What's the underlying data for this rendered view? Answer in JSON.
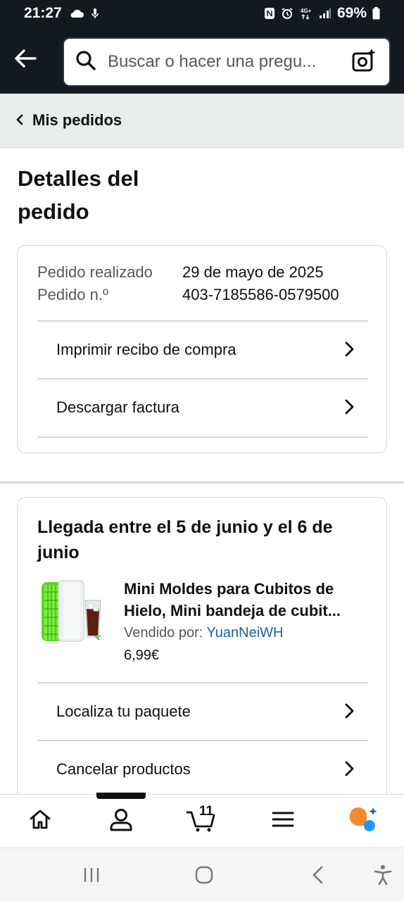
{
  "status_bar": {
    "time": "21:27",
    "battery": "69%"
  },
  "search": {
    "placeholder": "Buscar o hacer una pregu..."
  },
  "breadcrumb": {
    "label": "Mis pedidos"
  },
  "page": {
    "title": "Detalles del pedido"
  },
  "order": {
    "placed_label": "Pedido realizado",
    "placed_value": "29 de mayo de 2025",
    "number_label": "Pedido n.º",
    "number_value": "403-7185586-0579500",
    "actions": [
      {
        "label": "Imprimir recibo de compra"
      },
      {
        "label": "Descargar factura"
      }
    ]
  },
  "shipment": {
    "arrival": "Llegada entre el 5 de junio y el 6 de junio",
    "product": {
      "title": "Mini Moldes para Cubitos de Hielo, Mini bandeja de cubit...",
      "seller_label": "Vendido por:",
      "seller_name": "YuanNeiWH",
      "price": "6,99€"
    },
    "actions": [
      {
        "label": "Localiza tu paquete"
      },
      {
        "label": "Cancelar productos"
      }
    ]
  },
  "bottom_nav": {
    "cart_count": "11"
  },
  "colors": {
    "header_bg": "#131921",
    "link": "#2162a1",
    "alexa_orange": "#f28a2e",
    "alexa_blue": "#1a98ff"
  },
  "icons": [
    "back-arrow-icon",
    "search-icon",
    "camera-sparkle-icon",
    "chevron-left-icon",
    "chevron-right-icon",
    "home-icon",
    "account-icon",
    "cart-icon",
    "menu-icon",
    "rufus-icon"
  ]
}
